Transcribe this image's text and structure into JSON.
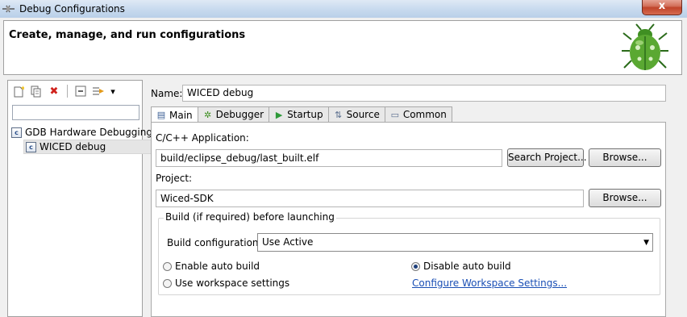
{
  "window": {
    "title": "Debug Configurations",
    "close_glyph": "x"
  },
  "banner": {
    "heading": "Create, manage, and run configurations",
    "icon": "bug-icon"
  },
  "toolbar": {
    "buttons": [
      "new-configuration-icon",
      "duplicate-icon",
      "delete-icon",
      "collapse-all-icon",
      "filter-icon"
    ],
    "delete_glyph": "✖",
    "dropdown_glyph": "▾"
  },
  "filter": {
    "value": "",
    "placeholder": ""
  },
  "tree": {
    "category": {
      "label": "GDB Hardware Debugging",
      "icon_glyph": "c"
    },
    "child": {
      "label": "WICED debug",
      "icon_glyph": "c"
    }
  },
  "config": {
    "name_label": "Name:",
    "name_value": "WICED debug",
    "tabs": [
      {
        "label": "Main",
        "glyph": "▤"
      },
      {
        "label": "Debugger",
        "glyph": "✲"
      },
      {
        "label": "Startup",
        "glyph": "▶"
      },
      {
        "label": "Source",
        "glyph": "⇅"
      },
      {
        "label": "Common",
        "glyph": "▭"
      }
    ],
    "main": {
      "app_label": "C/C++ Application:",
      "app_value": "build/eclipse_debug/last_built.elf",
      "search_project_button": "Search Project...",
      "browse_button": "Browse...",
      "project_label": "Project:",
      "project_value": "Wiced-SDK",
      "project_browse_button": "Browse...",
      "build_group_title": "Build (if required) before launching",
      "build_config_label": "Build configuration:",
      "build_config_value": "Use Active",
      "enable_auto_build": "Enable auto build",
      "disable_auto_build": "Disable auto build",
      "use_workspace_settings": "Use workspace settings",
      "configure_workspace_link": "Configure Workspace Settings...",
      "selected_build_option": "disable_auto_build"
    }
  },
  "colors": {
    "accent": "#1a4fb5",
    "delete": "#d0221c",
    "bug_green": "#5aa832"
  }
}
